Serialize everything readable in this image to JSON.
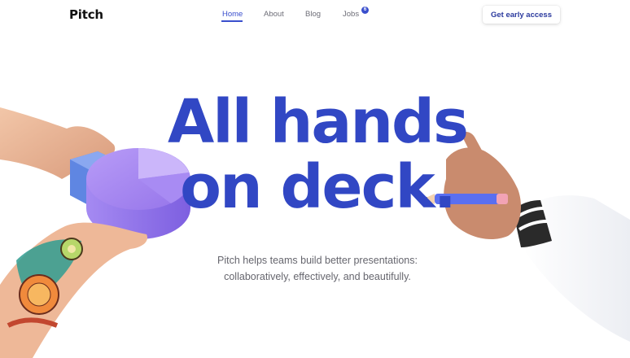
{
  "brand": {
    "logo_text": "Pitch"
  },
  "nav": {
    "items": [
      {
        "label": "Home",
        "active": true
      },
      {
        "label": "About"
      },
      {
        "label": "Blog"
      },
      {
        "label": "Jobs",
        "badge": "6"
      }
    ]
  },
  "cta": {
    "label": "Get early access"
  },
  "hero": {
    "headline_line1": "All hands",
    "headline_line2": "on deck.",
    "subtext_line1": "Pitch helps teams build better presentations:",
    "subtext_line2": "collaboratively, effectively, and beautifully."
  },
  "colors": {
    "accent": "#3147c4",
    "pie": "#9f7bf0",
    "pencil": "#5a6ff0"
  },
  "icons": {
    "left_illustration": "hand-holding-pie-chart",
    "right_illustration": "hand-holding-pencil"
  }
}
